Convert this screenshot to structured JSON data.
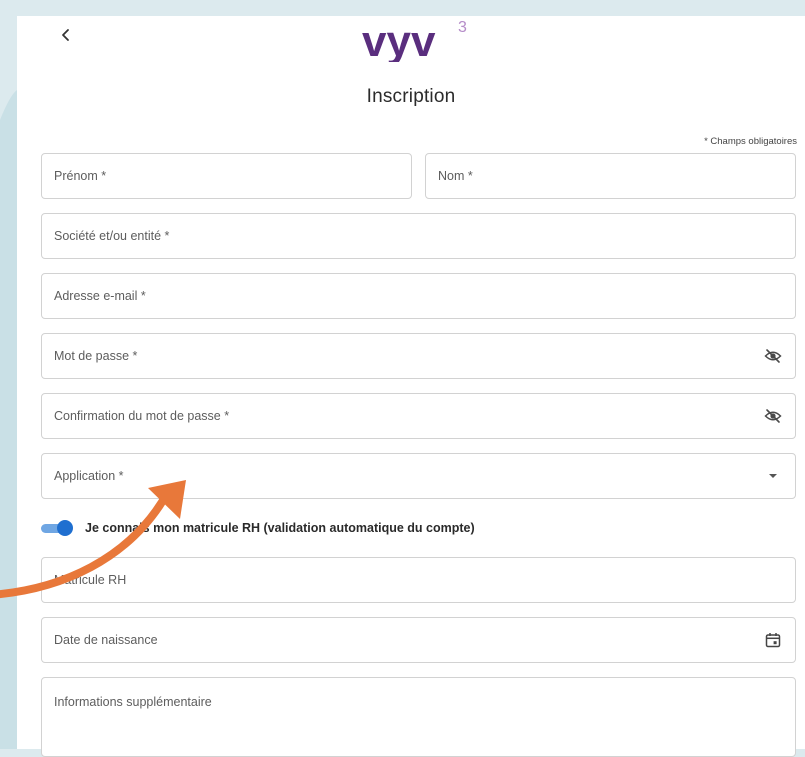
{
  "header": {
    "back_icon": "chevron-left-icon",
    "logo_text": "vyv",
    "logo_superscript": "3",
    "title": "Inscription"
  },
  "form": {
    "required_note": "* Champs obligatoires",
    "fields": {
      "first_name": {
        "label": "Prénom *"
      },
      "last_name": {
        "label": "Nom *"
      },
      "company": {
        "label": "Société et/ou entité *"
      },
      "email": {
        "label": "Adresse e-mail *"
      },
      "password": {
        "label": "Mot de passe *",
        "icon": "eye-off-icon"
      },
      "password_confirm": {
        "label": "Confirmation du mot de passe *",
        "icon": "eye-off-icon"
      },
      "application": {
        "label": "Application *",
        "icon": "caret-down-icon"
      },
      "hr_number": {
        "label": "Matricule RH"
      },
      "birth_date": {
        "label": "Date de naissance",
        "icon": "calendar-icon"
      },
      "additional_info": {
        "label": "Informations supplémentaire"
      }
    },
    "hr_toggle": {
      "label": "Je connais mon matricule RH (validation automatique du compte)",
      "checked": true
    }
  },
  "annotation": {
    "arrow_color": "#e8783a"
  },
  "colors": {
    "brand_purple": "#5a2e7e",
    "toggle_blue": "#1f6fd0",
    "background": "#dceaee"
  }
}
